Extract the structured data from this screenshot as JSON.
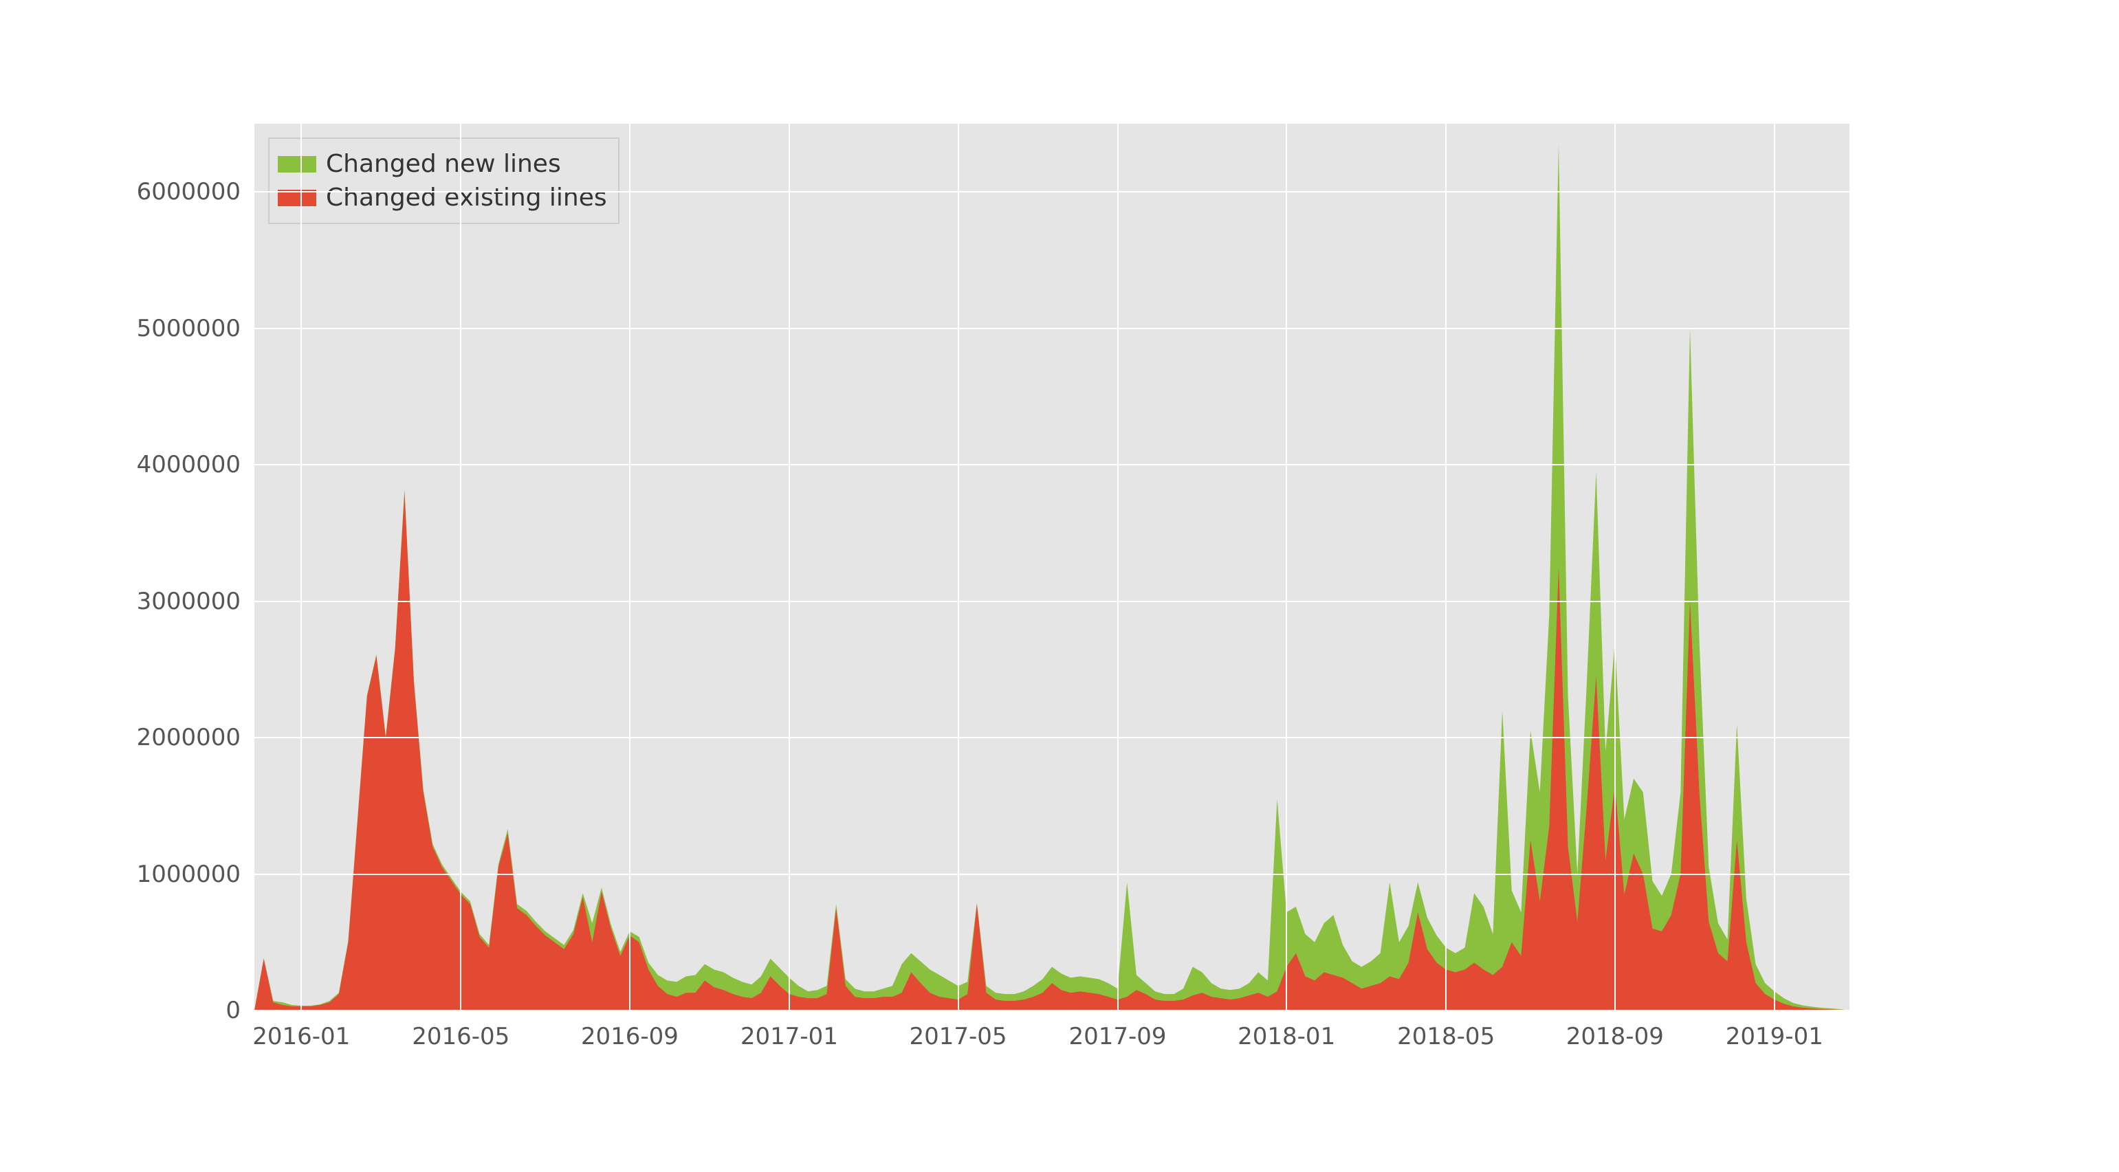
{
  "chart_data": {
    "type": "area",
    "title": "",
    "xlabel": "",
    "ylabel": "",
    "ylim": [
      0,
      6500000
    ],
    "x_tick_labels": [
      "2016-01",
      "2016-05",
      "2016-09",
      "2017-01",
      "2017-05",
      "2017-09",
      "2018-01",
      "2018-05",
      "2018-09",
      "2019-01"
    ],
    "y_tick_labels": [
      "0",
      "1000000",
      "2000000",
      "3000000",
      "4000000",
      "5000000",
      "6000000"
    ],
    "legend": [
      "Changed new lines",
      "Changed existing lines"
    ],
    "colors": {
      "Changed new lines": "#8bbf3e",
      "Changed existing lines": "#e24a33"
    },
    "x": [
      0,
      1,
      2,
      3,
      4,
      5,
      6,
      7,
      8,
      9,
      10,
      11,
      12,
      13,
      14,
      15,
      16,
      17,
      18,
      19,
      20,
      21,
      22,
      23,
      24,
      25,
      26,
      27,
      28,
      29,
      30,
      31,
      32,
      33,
      34,
      35,
      36,
      37,
      38,
      39,
      40,
      41,
      42,
      43,
      44,
      45,
      46,
      47,
      48,
      49,
      50,
      51,
      52,
      53,
      54,
      55,
      56,
      57,
      58,
      59,
      60,
      61,
      62,
      63,
      64,
      65,
      66,
      67,
      68,
      69,
      70,
      71,
      72,
      73,
      74,
      75,
      76,
      77,
      78,
      79,
      80,
      81,
      82,
      83,
      84,
      85,
      86,
      87,
      88,
      89,
      90,
      91,
      92,
      93,
      94,
      95,
      96,
      97,
      98,
      99,
      100,
      101,
      102,
      103,
      104,
      105,
      106,
      107,
      108,
      109,
      110,
      111,
      112,
      113,
      114,
      115,
      116,
      117,
      118,
      119,
      120,
      121,
      122,
      123,
      124,
      125,
      126,
      127,
      128,
      129,
      130,
      131,
      132,
      133,
      134,
      135,
      136,
      137,
      138,
      139,
      140,
      141,
      142,
      143,
      144,
      145,
      146,
      147,
      148,
      149,
      150,
      151,
      152,
      153,
      154,
      155,
      156,
      157,
      158,
      159,
      160,
      161,
      162,
      163,
      164,
      165,
      166,
      167,
      168,
      169,
      170
    ],
    "x_ticks_at": [
      5,
      22,
      40,
      57,
      75,
      92,
      110,
      127,
      145,
      162
    ],
    "x_range": [
      0,
      170
    ],
    "series": [
      {
        "name": "Changed existing lines",
        "values": [
          0,
          380000,
          60000,
          40000,
          30000,
          30000,
          30000,
          40000,
          60000,
          120000,
          500000,
          1400000,
          2300000,
          2600000,
          2000000,
          2650000,
          3800000,
          2400000,
          1600000,
          1200000,
          1050000,
          950000,
          850000,
          780000,
          540000,
          460000,
          1050000,
          1300000,
          750000,
          700000,
          620000,
          550000,
          500000,
          450000,
          560000,
          830000,
          500000,
          870000,
          600000,
          400000,
          550000,
          500000,
          300000,
          180000,
          120000,
          100000,
          130000,
          130000,
          220000,
          170000,
          150000,
          120000,
          100000,
          90000,
          130000,
          250000,
          180000,
          120000,
          100000,
          90000,
          90000,
          120000,
          750000,
          180000,
          100000,
          90000,
          90000,
          100000,
          100000,
          130000,
          280000,
          200000,
          130000,
          100000,
          90000,
          80000,
          120000,
          780000,
          130000,
          80000,
          70000,
          70000,
          80000,
          100000,
          130000,
          200000,
          150000,
          130000,
          140000,
          130000,
          120000,
          100000,
          80000,
          100000,
          150000,
          120000,
          80000,
          70000,
          70000,
          80000,
          110000,
          130000,
          100000,
          90000,
          80000,
          90000,
          110000,
          130000,
          100000,
          140000,
          320000,
          420000,
          250000,
          220000,
          280000,
          260000,
          240000,
          200000,
          160000,
          180000,
          200000,
          250000,
          230000,
          350000,
          720000,
          450000,
          350000,
          300000,
          280000,
          300000,
          350000,
          300000,
          260000,
          320000,
          500000,
          400000,
          1250000,
          800000,
          1350000,
          3250000,
          1200000,
          650000,
          1500000,
          2450000,
          1100000,
          1650000,
          850000,
          1150000,
          1000000,
          600000,
          580000,
          700000,
          1000000,
          3000000,
          1600000,
          650000,
          420000,
          360000,
          1250000,
          500000,
          200000,
          120000,
          80000,
          50000,
          30000,
          20000,
          15000,
          10000,
          8000,
          5000,
          0
        ]
      },
      {
        "name": "Changed new lines",
        "values": [
          0,
          380000,
          70000,
          60000,
          40000,
          35000,
          35000,
          45000,
          70000,
          130000,
          510000,
          1410000,
          2310000,
          2610000,
          2010000,
          2660000,
          3820000,
          2420000,
          1620000,
          1220000,
          1070000,
          970000,
          870000,
          800000,
          560000,
          480000,
          1070000,
          1330000,
          780000,
          730000,
          650000,
          580000,
          530000,
          480000,
          590000,
          860000,
          640000,
          900000,
          630000,
          430000,
          580000,
          540000,
          350000,
          260000,
          220000,
          210000,
          250000,
          260000,
          340000,
          300000,
          280000,
          240000,
          210000,
          190000,
          250000,
          380000,
          310000,
          240000,
          180000,
          140000,
          150000,
          180000,
          780000,
          230000,
          160000,
          140000,
          140000,
          160000,
          180000,
          340000,
          420000,
          360000,
          300000,
          260000,
          220000,
          180000,
          210000,
          790000,
          180000,
          130000,
          120000,
          120000,
          140000,
          180000,
          230000,
          320000,
          270000,
          240000,
          250000,
          240000,
          230000,
          200000,
          160000,
          940000,
          260000,
          200000,
          140000,
          120000,
          120000,
          160000,
          320000,
          280000,
          200000,
          160000,
          150000,
          160000,
          200000,
          280000,
          220000,
          1550000,
          720000,
          760000,
          560000,
          500000,
          640000,
          700000,
          480000,
          360000,
          320000,
          360000,
          420000,
          940000,
          500000,
          620000,
          940000,
          680000,
          550000,
          460000,
          420000,
          460000,
          860000,
          760000,
          560000,
          2200000,
          880000,
          720000,
          2050000,
          1600000,
          2900000,
          6350000,
          2300000,
          1000000,
          2400000,
          3950000,
          1900000,
          2700000,
          1400000,
          1700000,
          1600000,
          950000,
          840000,
          1000000,
          1600000,
          5000000,
          2700000,
          1050000,
          640000,
          520000,
          2100000,
          820000,
          340000,
          200000,
          140000,
          90000,
          55000,
          38000,
          28000,
          20000,
          15000,
          10000,
          0
        ]
      }
    ]
  }
}
